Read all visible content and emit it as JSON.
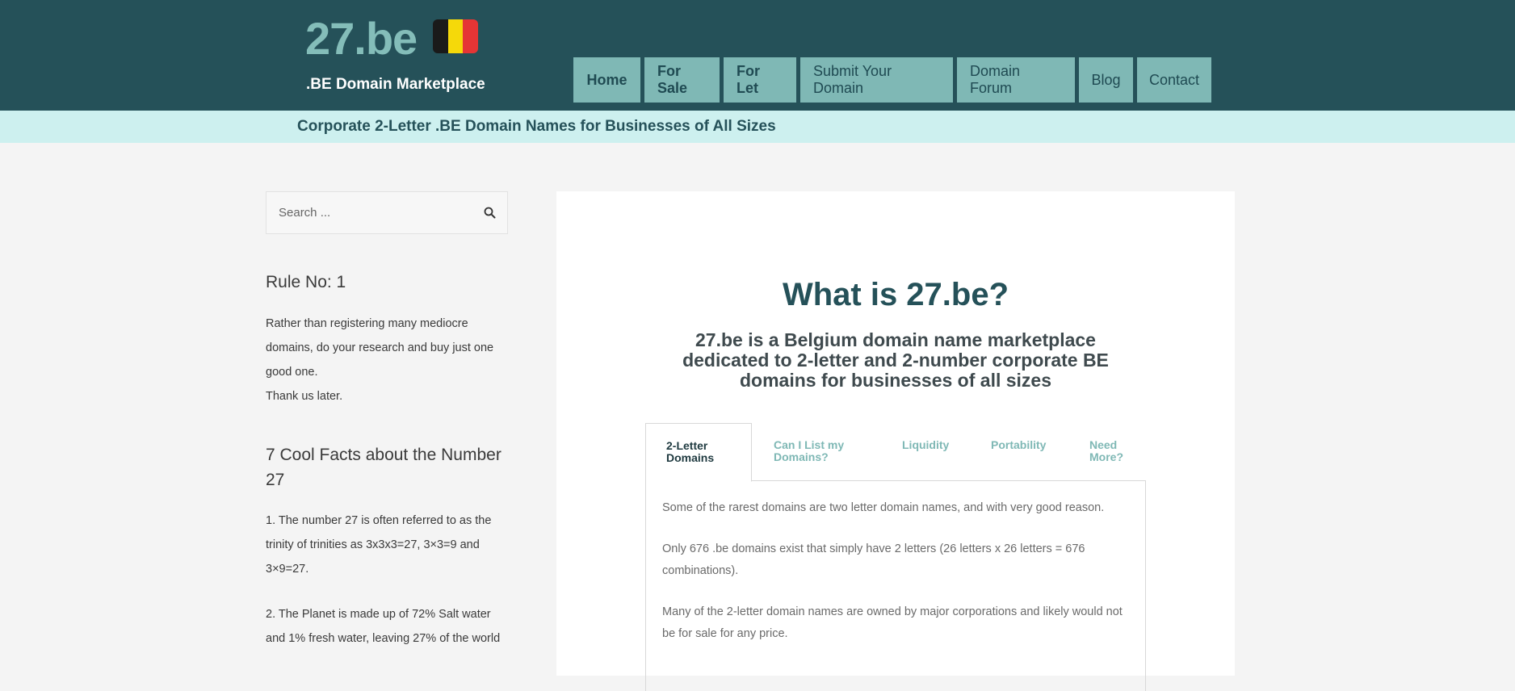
{
  "header": {
    "logo": "27.be",
    "tagline": ".BE Domain Marketplace",
    "flag_colors": [
      "#1a1a1a",
      "#f5d90a",
      "#e53535"
    ],
    "nav": [
      {
        "label": "Home",
        "bold": true
      },
      {
        "label": "For Sale",
        "bold": true
      },
      {
        "label": "For Let",
        "bold": true
      },
      {
        "label": "Submit Your Domain",
        "bold": false
      },
      {
        "label": "Domain Forum",
        "bold": false
      },
      {
        "label": "Blog",
        "bold": false
      },
      {
        "label": "Contact",
        "bold": false
      }
    ]
  },
  "banner": {
    "text": "Corporate 2-Letter .BE Domain Names for Businesses of All Sizes"
  },
  "sidebar": {
    "search": {
      "placeholder": "Search ...",
      "icon": "search-icon"
    },
    "rule": {
      "title": "Rule No: 1",
      "lines": [
        "Rather than registering many mediocre domains, do your research and buy just one good one.",
        "Thank us later."
      ]
    },
    "facts": {
      "title": "7 Cool Facts about the Number 27",
      "items": [
        "1. The number 27 is often referred to as the trinity of trinities as 3x3x3=27, 3×3=9 and 3×9=27.",
        "2. The Planet is made up of 72% Salt water and 1% fresh water, leaving 27% of the world"
      ]
    }
  },
  "main": {
    "title": "What is 27.be?",
    "subtitle": "27.be is a Belgium domain name marketplace dedicated to 2-letter and 2-number corporate BE domains for businesses of all sizes",
    "tabs": [
      {
        "label": "2-Letter Domains",
        "active": true
      },
      {
        "label": "Can I List my Domains?",
        "active": false
      },
      {
        "label": "Liquidity",
        "active": false
      },
      {
        "label": "Portability",
        "active": false
      },
      {
        "label": "Need More?",
        "active": false
      }
    ],
    "panel": [
      "Some of the rarest domains are two letter domain names, and with very good reason.",
      "Only 676 .be domains exist that simply have 2 letters (26 letters x 26 letters = 676 combinations).",
      "Many of the 2-letter domain names are owned by major corporations and likely would not be for sale for any price."
    ]
  },
  "colors": {
    "header_bg": "#255159",
    "accent": "#7fb8b5",
    "banner_bg": "#cdf0ef",
    "page_bg": "#f4f4f4"
  }
}
